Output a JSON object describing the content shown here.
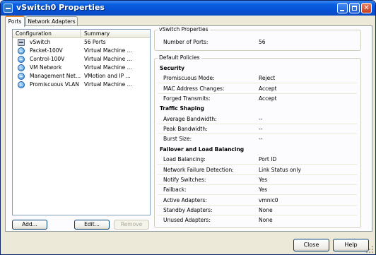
{
  "window": {
    "title": "vSwitch0 Properties"
  },
  "tabs": [
    {
      "label": "Ports"
    },
    {
      "label": "Network Adapters"
    }
  ],
  "list": {
    "headers": {
      "configuration": "Configuration",
      "summary": "Summary"
    },
    "rows": [
      {
        "icon": "vswitch-icon",
        "configuration": "vSwitch",
        "summary": "56 Ports"
      },
      {
        "icon": "portgroup-icon",
        "configuration": "Packet-100V",
        "summary": "Virtual Machine ..."
      },
      {
        "icon": "portgroup-icon",
        "configuration": "Control-100V",
        "summary": "Virtual Machine ..."
      },
      {
        "icon": "portgroup-icon",
        "configuration": "VM Network",
        "summary": "Virtual Machine ..."
      },
      {
        "icon": "portgroup-icon",
        "configuration": "Management Net...",
        "summary": "VMotion and IP ..."
      },
      {
        "icon": "portgroup-icon",
        "configuration": "Promiscuous VLAN",
        "summary": "Virtual Machine ..."
      }
    ]
  },
  "buttons": {
    "add": "Add...",
    "edit": "Edit...",
    "remove": "Remove",
    "close": "Close",
    "help": "Help"
  },
  "vswitch_properties": {
    "title": "vSwitch Properties",
    "ports_label": "Number of Ports:",
    "ports_value": "56"
  },
  "default_policies": {
    "title": "Default Policies",
    "security": {
      "heading": "Security",
      "items": [
        {
          "label": "Promiscuous Mode:",
          "value": "Reject"
        },
        {
          "label": "MAC Address Changes:",
          "value": "Accept"
        },
        {
          "label": "Forged Transmits:",
          "value": "Accept"
        }
      ]
    },
    "traffic_shaping": {
      "heading": "Traffic Shaping",
      "items": [
        {
          "label": "Average Bandwidth:",
          "value": "--"
        },
        {
          "label": "Peak Bandwidth:",
          "value": "--"
        },
        {
          "label": "Burst Size:",
          "value": "--"
        }
      ]
    },
    "failover": {
      "heading": "Failover and Load Balancing",
      "items": [
        {
          "label": "Load Balancing:",
          "value": "Port ID"
        },
        {
          "label": "Network Failure Detection:",
          "value": "Link Status only"
        },
        {
          "label": "Notify Switches:",
          "value": "Yes"
        },
        {
          "label": "Failback:",
          "value": "Yes"
        },
        {
          "label": "Active Adapters:",
          "value": "vmnic0"
        },
        {
          "label": "Standby Adapters:",
          "value": "None"
        },
        {
          "label": "Unused Adapters:",
          "value": "None"
        }
      ]
    }
  },
  "colors": {
    "titlebar": "#0553d6",
    "window_bg": "#ece9d8",
    "tab_highlight": "#e68b2c"
  }
}
